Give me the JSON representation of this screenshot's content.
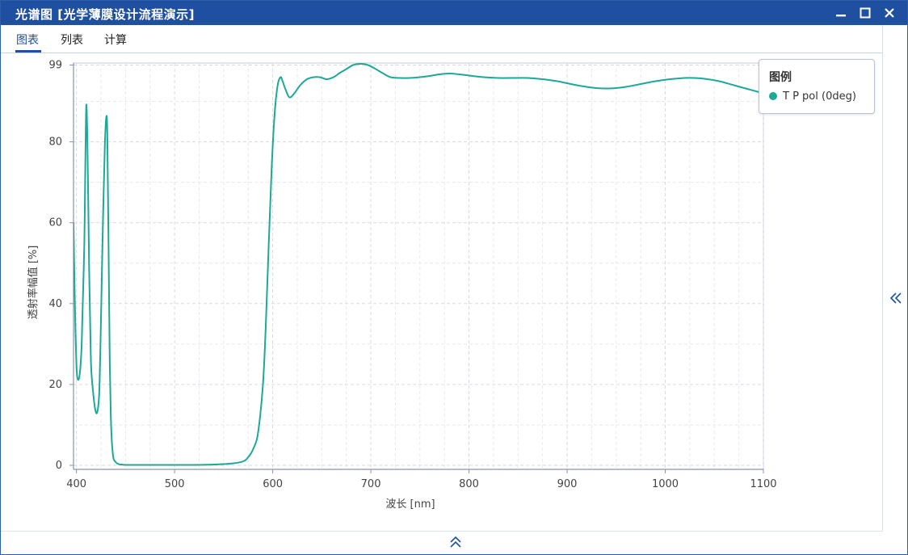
{
  "window": {
    "title": "光谱图 [光学薄膜设计流程演示]"
  },
  "tabs": [
    {
      "label": "图表",
      "active": true
    },
    {
      "label": "列表",
      "active": false
    },
    {
      "label": "计算",
      "active": false
    }
  ],
  "colors": {
    "titlebar": "#1f4fa0",
    "series": "#1ea896",
    "accent": "#1f4fa0"
  },
  "icons": {
    "minimize": "minimize-icon",
    "maximize": "maximize-icon",
    "close": "close-icon",
    "collapse_right": "double-chevron-left-icon",
    "collapse_bottom": "double-chevron-up-icon"
  },
  "legend": {
    "title": "图例"
  },
  "chart_data": {
    "type": "line",
    "xlabel": "波长 [nm]",
    "ylabel": "透射率幅值 [%]",
    "xlim": [
      397,
      1100
    ],
    "ylim": [
      -1,
      99.5
    ],
    "xticks": [
      400,
      500,
      600,
      700,
      800,
      900,
      1000,
      1100
    ],
    "yticks": [
      0,
      20,
      40,
      60,
      80,
      99
    ],
    "grid": true,
    "legend_position": "top-right",
    "series": [
      {
        "name": "T P pol (0deg)",
        "color": "#1ea896",
        "x": [
          397,
          398,
          399,
          400,
          401,
          403,
          405,
          406,
          408,
          409,
          410,
          411,
          412,
          413,
          414,
          415,
          417,
          419,
          421,
          423,
          424,
          425,
          427,
          429,
          431,
          432,
          433,
          434,
          435,
          436,
          437,
          438,
          440,
          442,
          445,
          450,
          460,
          480,
          500,
          520,
          540,
          560,
          570,
          575,
          580,
          585,
          590,
          593,
          596,
          599,
          602,
          605,
          608,
          610,
          613,
          617,
          622,
          628,
          635,
          642,
          648,
          655,
          662,
          668,
          675,
          682,
          690,
          697,
          705,
          712,
          720,
          730,
          740,
          750,
          760,
          770,
          780,
          790,
          800,
          815,
          830,
          845,
          860,
          875,
          890,
          900,
          910,
          920,
          930,
          940,
          950,
          960,
          975,
          990,
          1005,
          1020,
          1030,
          1040,
          1055,
          1070,
          1085,
          1100
        ],
        "y": [
          60,
          45,
          33,
          25,
          21.5,
          22,
          28,
          36,
          55,
          74,
          89,
          82,
          66,
          48,
          34,
          24,
          18,
          14,
          13,
          17,
          25,
          36,
          60,
          80,
          86,
          70,
          48,
          25,
          12,
          6,
          3,
          1.5,
          0.8,
          0.4,
          0.2,
          0.1,
          0.1,
          0.1,
          0.1,
          0.1,
          0.2,
          0.5,
          1,
          2,
          4,
          8,
          20,
          35,
          55,
          74,
          87,
          94,
          96,
          95,
          93,
          91,
          92,
          94,
          95.5,
          96,
          96,
          95.5,
          96,
          97,
          98,
          99,
          99.3,
          99,
          98,
          97,
          96,
          95.8,
          95.8,
          96,
          96.3,
          96.7,
          96.9,
          96.7,
          96.4,
          96,
          95.8,
          95.8,
          95.8,
          95.5,
          95,
          94.5,
          94,
          93.6,
          93.3,
          93.2,
          93.3,
          93.6,
          94.3,
          95,
          95.5,
          95.8,
          95.8,
          95.6,
          95,
          94,
          93,
          92
        ]
      }
    ]
  }
}
